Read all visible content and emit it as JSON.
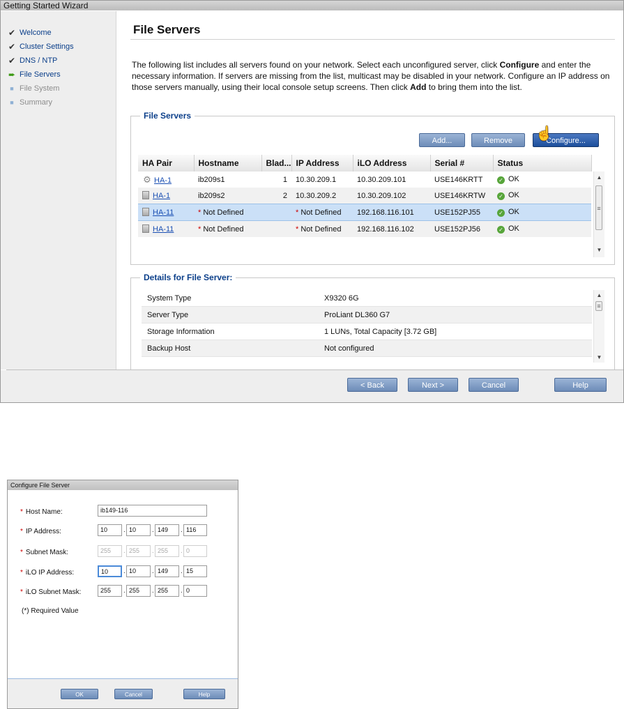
{
  "wizard": {
    "title": "Getting Started Wizard",
    "steps": [
      {
        "label": "Welcome",
        "state": "done"
      },
      {
        "label": "Cluster Settings",
        "state": "done"
      },
      {
        "label": "DNS / NTP",
        "state": "done"
      },
      {
        "label": "File Servers",
        "state": "current"
      },
      {
        "label": "File System",
        "state": "future"
      },
      {
        "label": "Summary",
        "state": "future"
      }
    ],
    "page_title": "File Servers",
    "intro": {
      "p1": "The following list includes all servers found on your network. Select each unconfigured server, click ",
      "b1": "Configure",
      "p2": " and enter the necessary information. If servers are missing from the list, multicast may be disabled in your network. Configure an IP address on those servers manually, using their local console setup screens. Then click ",
      "b2": "Add",
      "p3": " to bring them into the list."
    },
    "servers_group": {
      "legend": "File Servers",
      "add_label": "Add...",
      "remove_label": "Remove",
      "configure_label": "Configure...",
      "columns": [
        "HA Pair",
        "Hostname",
        "Blad...",
        "IP Address",
        "iLO Address",
        "Serial #",
        "Status"
      ],
      "rows": [
        {
          "ha_pair": "HA-1",
          "hostname": "ib209s1",
          "host_required": false,
          "blade": "1",
          "ip": "10.30.209.1",
          "ip_required": false,
          "ilo": "10.30.209.101",
          "serial": "USE146KRTT",
          "status": "OK"
        },
        {
          "ha_pair": "HA-1",
          "hostname": "ib209s2",
          "host_required": false,
          "blade": "2",
          "ip": "10.30.209.2",
          "ip_required": false,
          "ilo": "10.30.209.102",
          "serial": "USE146KRTW",
          "status": "OK"
        },
        {
          "ha_pair": "HA-11",
          "hostname": "Not Defined",
          "host_required": true,
          "blade": "",
          "ip": "Not Defined",
          "ip_required": true,
          "ilo": "192.168.116.101",
          "serial": "USE152PJ55",
          "status": "OK"
        },
        {
          "ha_pair": "HA-11",
          "hostname": "Not Defined",
          "host_required": true,
          "blade": "",
          "ip": "Not Defined",
          "ip_required": true,
          "ilo": "192.168.116.102",
          "serial": "USE152PJ56",
          "status": "OK"
        }
      ],
      "required_mark": "*"
    },
    "details_group": {
      "legend": "Details for File Server:",
      "rows": [
        {
          "key": "System Type",
          "value": "X9320 6G"
        },
        {
          "key": "Server Type",
          "value": "ProLiant DL360 G7"
        },
        {
          "key": "Storage Information",
          "value": "1 LUNs, Total Capacity [3.72 GB]"
        },
        {
          "key": "Backup Host",
          "value": "Not configured"
        }
      ]
    },
    "footer": {
      "back_label": "< Back",
      "next_label": "Next >",
      "cancel_label": "Cancel",
      "help_label": "Help"
    }
  },
  "dialog": {
    "title": "Configure File Server",
    "required_mark": "*",
    "host_name_label": "Host Name:",
    "host_name_value": "ib149-116",
    "ip_label": "IP Address:",
    "ip_octets": [
      "10",
      "10",
      "149",
      "116"
    ],
    "subnet_label": "Subnet Mask:",
    "subnet_octets": [
      "255",
      "255",
      "255",
      "0"
    ],
    "ilo_ip_label": "iLO IP Address:",
    "ilo_ip_octets": [
      "10",
      "10",
      "149",
      "15"
    ],
    "ilo_subnet_label": "iLO Subnet Mask:",
    "ilo_subnet_octets": [
      "255",
      "255",
      "255",
      "0"
    ],
    "octet_separator": ".",
    "note": "(*) Required Value",
    "ok_label": "OK",
    "cancel_label": "Cancel",
    "help_label": "Help"
  }
}
